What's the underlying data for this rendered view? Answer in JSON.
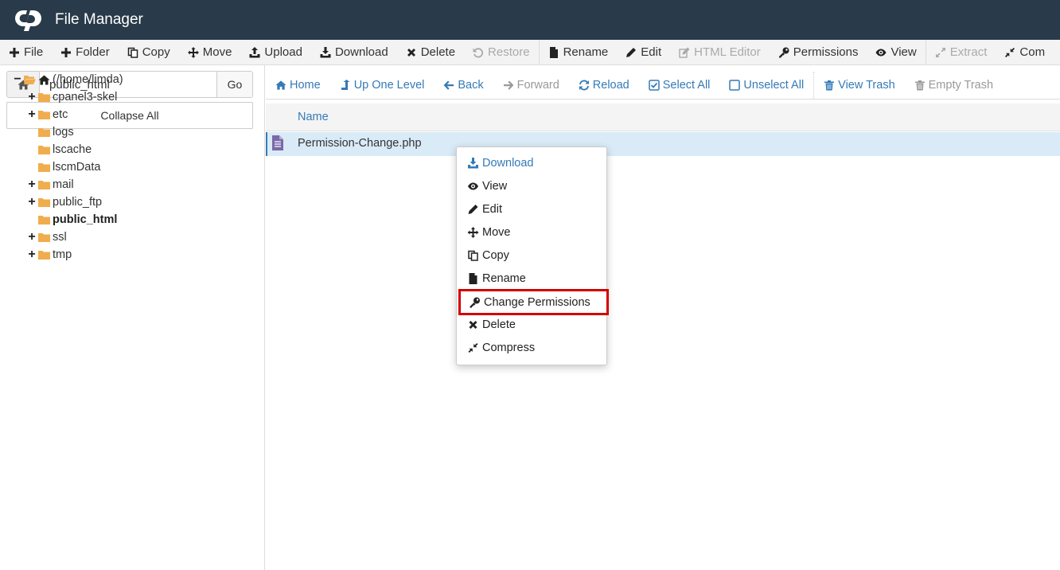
{
  "app": {
    "title": "File Manager"
  },
  "toolbar": {
    "items": [
      {
        "label": "File",
        "icon": "plus-icon"
      },
      {
        "label": "Folder",
        "icon": "plus-icon"
      },
      {
        "label": "Copy",
        "icon": "copy-icon"
      },
      {
        "label": "Move",
        "icon": "move-icon"
      },
      {
        "label": "Upload",
        "icon": "upload-icon"
      },
      {
        "label": "Download",
        "icon": "download-icon"
      },
      {
        "label": "Delete",
        "icon": "times-icon"
      },
      {
        "label": "Restore",
        "icon": "undo-icon",
        "disabled": true
      },
      {
        "label": "Rename",
        "icon": "file-icon"
      },
      {
        "label": "Edit",
        "icon": "pencil-icon"
      },
      {
        "label": "HTML Editor",
        "icon": "edit-icon",
        "disabled": true
      },
      {
        "label": "Permissions",
        "icon": "key-icon"
      },
      {
        "label": "View",
        "icon": "eye-icon"
      },
      {
        "label": "Extract",
        "icon": "expand-icon",
        "disabled": true
      },
      {
        "label": "Com",
        "icon": "compress-icon"
      }
    ]
  },
  "address": {
    "path": "public_html",
    "go_label": "Go"
  },
  "sidebar": {
    "collapse_label": "Collapse All",
    "tree": [
      {
        "label": "(/home/limda)",
        "toggle": "−",
        "root": true
      },
      {
        "label": "cpanel3-skel",
        "toggle": "+"
      },
      {
        "label": "etc",
        "toggle": "+"
      },
      {
        "label": "logs",
        "toggle": ""
      },
      {
        "label": "lscache",
        "toggle": ""
      },
      {
        "label": "lscmData",
        "toggle": ""
      },
      {
        "label": "mail",
        "toggle": "+"
      },
      {
        "label": "public_ftp",
        "toggle": "+"
      },
      {
        "label": "public_html",
        "toggle": "",
        "bold": true
      },
      {
        "label": "ssl",
        "toggle": "+"
      },
      {
        "label": "tmp",
        "toggle": "+"
      }
    ]
  },
  "nav": {
    "home": "Home",
    "up": "Up One Level",
    "back": "Back",
    "forward": "Forward",
    "reload": "Reload",
    "select_all": "Select All",
    "unselect_all": "Unselect All",
    "view_trash": "View Trash",
    "empty_trash": "Empty Trash"
  },
  "list": {
    "column_name": "Name",
    "files": [
      {
        "name": "Permission-Change.php",
        "selected": true
      }
    ]
  },
  "context_menu": {
    "items": [
      {
        "label": "Download",
        "icon": "download-icon"
      },
      {
        "label": "View",
        "icon": "eye-icon"
      },
      {
        "label": "Edit",
        "icon": "pencil-icon"
      },
      {
        "label": "Move",
        "icon": "move-icon"
      },
      {
        "label": "Copy",
        "icon": "copy-icon"
      },
      {
        "label": "Rename",
        "icon": "file-icon"
      },
      {
        "label": "Change Permissions",
        "icon": "key-icon",
        "highlighted": true
      },
      {
        "label": "Delete",
        "icon": "times-icon"
      },
      {
        "label": "Compress",
        "icon": "compress-icon"
      }
    ]
  },
  "colors": {
    "topbar": "#293a4a",
    "link": "#337ab7",
    "folder": "#f0ad4e",
    "selected_row": "#d9ebf7",
    "highlight_outline": "#d40000"
  }
}
